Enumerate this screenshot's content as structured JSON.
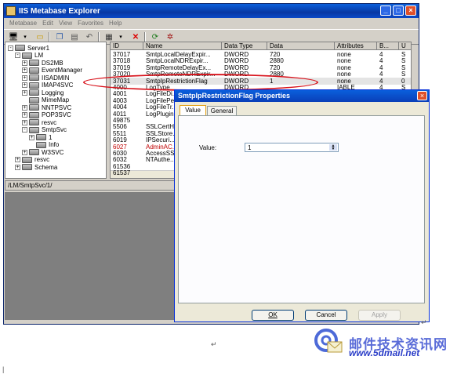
{
  "window": {
    "title": "IIS Metabase Explorer",
    "controls": {
      "minimize": "_",
      "maximize": "□",
      "close": "×"
    }
  },
  "menu": [
    "Metabase",
    "Edit",
    "View",
    "Favorites",
    "Help"
  ],
  "toolbar_icons": [
    "computer-icon",
    "open-icon",
    "copy-icon",
    "paste-icon",
    "undo-icon",
    "properties-icon",
    "delete-icon",
    "refresh-icon",
    "settings-icon"
  ],
  "tree": [
    {
      "label": "Server1",
      "level": 0,
      "expander": "-"
    },
    {
      "label": "LM",
      "level": 1,
      "expander": "-"
    },
    {
      "label": "DS2MB",
      "level": 2,
      "expander": "+"
    },
    {
      "label": "EventManager",
      "level": 2,
      "expander": "+"
    },
    {
      "label": "IISADMIN",
      "level": 2,
      "expander": "+"
    },
    {
      "label": "IMAP4SVC",
      "level": 2,
      "expander": "+"
    },
    {
      "label": "Logging",
      "level": 2,
      "expander": "+"
    },
    {
      "label": "MimeMap",
      "level": 2,
      "expander": ""
    },
    {
      "label": "NNTPSVC",
      "level": 2,
      "expander": "+"
    },
    {
      "label": "POP3SVC",
      "level": 2,
      "expander": "+"
    },
    {
      "label": "resvc",
      "level": 2,
      "expander": "+"
    },
    {
      "label": "SmtpSvc",
      "level": 2,
      "expander": "-"
    },
    {
      "label": "1",
      "level": 3,
      "expander": "+"
    },
    {
      "label": "Info",
      "level": 3,
      "expander": ""
    },
    {
      "label": "W3SVC",
      "level": 2,
      "expander": "+"
    },
    {
      "label": "resvc",
      "level": 1,
      "expander": "+"
    },
    {
      "label": "Schema",
      "level": 1,
      "expander": "+"
    }
  ],
  "list": {
    "columns": [
      "ID",
      "Name",
      "Data Type",
      "Data",
      "Attributes",
      "B...",
      "U"
    ],
    "rows": [
      [
        "37017",
        "SmtpLocalDelayExpir...",
        "DWORD",
        "720",
        "none",
        "4",
        "S"
      ],
      [
        "37018",
        "SmtpLocalNDRExpir...",
        "DWORD",
        "2880",
        "none",
        "4",
        "S"
      ],
      [
        "37019",
        "SmtpRemoteDelayEx...",
        "DWORD",
        "720",
        "none",
        "4",
        "S"
      ],
      [
        "37020",
        "SmtpRemoteNDRExpir...",
        "DWORD",
        "2880",
        "none",
        "4",
        "S"
      ],
      [
        "37031",
        "SmtpIpRestrictionFlag",
        "DWORD",
        "1",
        "none",
        "4",
        "0"
      ],
      [
        "4000",
        "LogType",
        "DWORD",
        "",
        "IABLE",
        "4",
        "S"
      ],
      [
        "4001",
        "LogFileDi...",
        "",
        "",
        "",
        "",
        ""
      ],
      [
        "4003",
        "LogFilePe...",
        "",
        "",
        "",
        "",
        ""
      ],
      [
        "4004",
        "LogFileTr...",
        "",
        "",
        "",
        "",
        ""
      ],
      [
        "4011",
        "LogPlugin...",
        "",
        "",
        "",
        "",
        ""
      ],
      [
        "49875",
        "",
        "",
        "",
        "",
        "",
        ""
      ],
      [
        "5506",
        "SSLCertH...",
        "",
        "",
        "",
        "",
        ""
      ],
      [
        "5511",
        "SSLStore...",
        "",
        "",
        "",
        "",
        ""
      ],
      [
        "6019",
        "IPSecuri...",
        "",
        "",
        "",
        "",
        ""
      ],
      [
        "6027",
        "AdminAC...",
        "",
        "",
        "",
        "",
        ""
      ],
      [
        "6030",
        "AccessSS...",
        "",
        "",
        "",
        "",
        ""
      ],
      [
        "6032",
        "NTAuthe...",
        "",
        "",
        "",
        "",
        ""
      ],
      [
        "61536",
        "",
        "",
        "",
        "",
        "",
        ""
      ],
      [
        "61537",
        "",
        "",
        "",
        "",
        "",
        ""
      ]
    ],
    "red_row_index": 14,
    "red_color": "#c00000"
  },
  "status": {
    "path": "/LM/SmtpSvc/1/"
  },
  "dialog": {
    "title": "SmtpIpRestrictionFlag Properties",
    "tabs": [
      "Value",
      "General"
    ],
    "value_label": "Value:",
    "value": "1",
    "buttons": {
      "ok": "OK",
      "cancel": "Cancel",
      "apply": "Apply"
    }
  },
  "watermark": {
    "line1": "邮件技术资讯网",
    "line2": "www.5dmail.net"
  },
  "doc_marks": {
    "return1": "↵",
    "return2": "↵",
    "cursor": "|"
  },
  "colors": {
    "titlebar": "#0a49c8",
    "highlight_ellipse": "#d8121b",
    "dialog_border": "#0831d9"
  }
}
